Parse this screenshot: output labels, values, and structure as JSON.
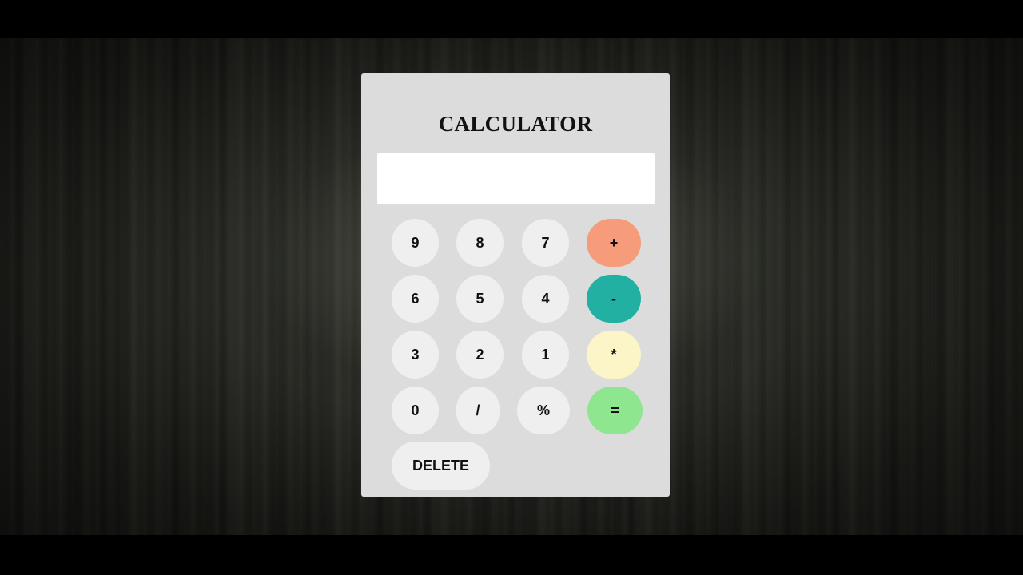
{
  "calculator": {
    "title": "CALCULATOR",
    "display_value": "",
    "keys": [
      {
        "label": "9",
        "color": "#efefef"
      },
      {
        "label": "8",
        "color": "#efefef"
      },
      {
        "label": "7",
        "color": "#efefef"
      },
      {
        "label": "+",
        "color": "#f79c7a"
      },
      {
        "label": "6",
        "color": "#efefef"
      },
      {
        "label": "5",
        "color": "#efefef"
      },
      {
        "label": "4",
        "color": "#efefef"
      },
      {
        "label": "-",
        "color": "#21b0a2"
      },
      {
        "label": "3",
        "color": "#efefef"
      },
      {
        "label": "2",
        "color": "#efefef"
      },
      {
        "label": "1",
        "color": "#efefef"
      },
      {
        "label": "*",
        "color": "#fbf5c8"
      },
      {
        "label": "0",
        "color": "#efefef"
      },
      {
        "label": "/",
        "color": "#efefef"
      },
      {
        "label": "%",
        "color": "#efefef"
      },
      {
        "label": "=",
        "color": "#8ee68f"
      },
      {
        "label": "DELETE",
        "color": "#efefef"
      }
    ]
  }
}
